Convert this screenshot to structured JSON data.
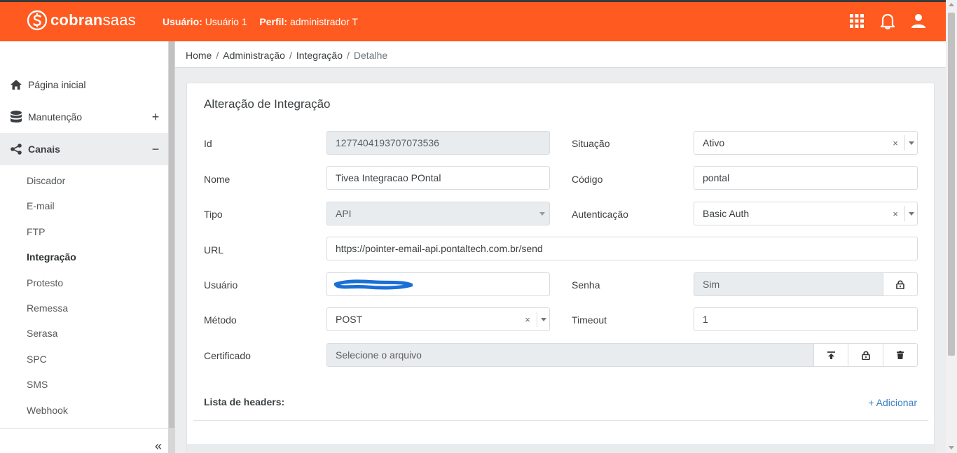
{
  "brand": {
    "name_bold": "cobran",
    "name_light": "saas",
    "color": "#ff5a1f"
  },
  "header": {
    "user_label": "Usuário:",
    "user_value": "Usuário 1",
    "profile_label": "Perfil:",
    "profile_value": "administrador T",
    "icons": [
      "apps-grid-icon",
      "bell-icon",
      "user-icon"
    ]
  },
  "sidebar": {
    "items": [
      {
        "label": "Página inicial",
        "icon": "home-icon"
      },
      {
        "label": "Manutenção",
        "icon": "database-icon",
        "toggle": "+"
      },
      {
        "label": "Canais",
        "icon": "share-icon",
        "toggle": "−"
      }
    ],
    "sub_items": [
      "Discador",
      "E-mail",
      "FTP",
      "Integração",
      "Protesto",
      "Remessa",
      "Serasa",
      "SPC",
      "SMS",
      "Webhook"
    ],
    "current_sub": "Integração",
    "collapse_glyph": "«"
  },
  "breadcrumb": [
    "Home",
    "Administração",
    "Integração",
    "Detalhe"
  ],
  "form": {
    "title": "Alteração de Integração",
    "id": {
      "label": "Id",
      "value": "1277404193707073536"
    },
    "situacao": {
      "label": "Situação",
      "value": "Ativo"
    },
    "nome": {
      "label": "Nome",
      "value": "Tivea Integracao POntal"
    },
    "codigo": {
      "label": "Código",
      "value": "pontal"
    },
    "tipo": {
      "label": "Tipo",
      "value": "API"
    },
    "autenticacao": {
      "label": "Autenticação",
      "value": "Basic Auth"
    },
    "url": {
      "label": "URL",
      "value": "https://pointer-email-api.pontaltech.com.br/send"
    },
    "usuario": {
      "label": "Usuário",
      "value": ""
    },
    "senha": {
      "label": "Senha",
      "value": "Sim"
    },
    "metodo": {
      "label": "Método",
      "value": "POST"
    },
    "timeout": {
      "label": "Timeout",
      "value": "1"
    },
    "certificado": {
      "label": "Certificado",
      "placeholder": "Selecione o arquivo"
    },
    "clear_glyph": "×",
    "headers_label": "Lista de headers:",
    "add_label": "+ Adicionar"
  }
}
